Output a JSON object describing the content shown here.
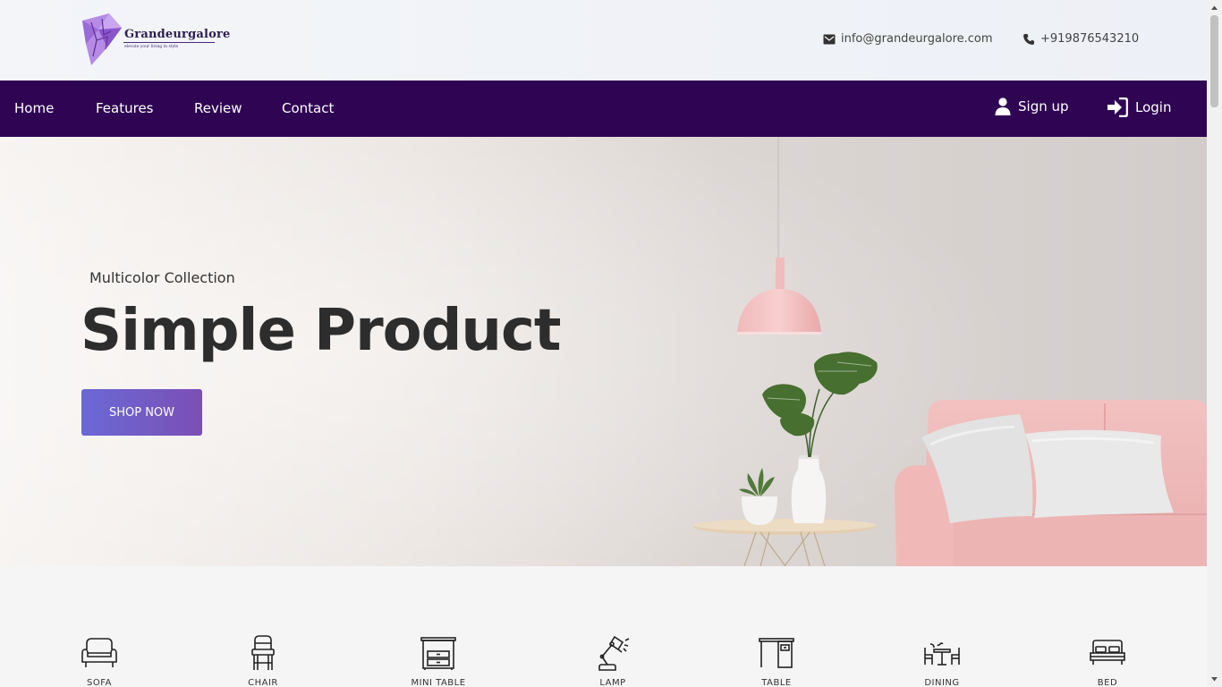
{
  "brand": {
    "name": "Grandeurgalore",
    "tagline": "elevate your living in style"
  },
  "contact": {
    "email": "info@grandeurgalore.com",
    "phone": "+919876543210"
  },
  "nav": {
    "links": [
      "Home",
      "Features",
      "Review",
      "Contact"
    ],
    "signup": "Sign up",
    "login": "Login"
  },
  "hero": {
    "subtitle": "Multicolor Collection",
    "title": "Simple Product",
    "button": "SHOP NOW"
  },
  "categories": [
    {
      "label": "SOFA",
      "icon": "armchair-icon"
    },
    {
      "label": "CHAIR",
      "icon": "chair-icon"
    },
    {
      "label": "MINI TABLE",
      "icon": "nightstand-icon"
    },
    {
      "label": "LAMP",
      "icon": "desk-lamp-icon"
    },
    {
      "label": "TABLE",
      "icon": "desk-icon"
    },
    {
      "label": "DINING",
      "icon": "dining-set-icon"
    },
    {
      "label": "BED",
      "icon": "bed-icon"
    }
  ],
  "colors": {
    "nav_bg": "#2f0553",
    "accent_start": "#6a69d6",
    "accent_end": "#7b4fb4"
  }
}
